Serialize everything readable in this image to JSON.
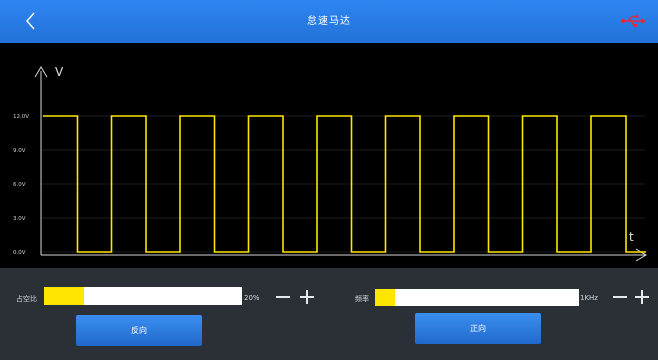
{
  "header": {
    "title": "怠速马达",
    "back_icon": "chevron-left-icon",
    "usb_icon": "usb-icon",
    "usb_color": "#e8283a"
  },
  "scope": {
    "axis_y_label": "V",
    "axis_x_label": "t",
    "y_ticks": [
      "12.0V",
      "9.0V",
      "6.0V",
      "3.0V",
      "0.0V"
    ],
    "trace_color": "#ffe600"
  },
  "chart_data": {
    "type": "line",
    "title": "",
    "xlabel": "t",
    "ylabel": "V",
    "ylim": [
      0,
      12
    ],
    "y_ticks": [
      0,
      3,
      6,
      9,
      12
    ],
    "waveform": "square",
    "high": 12.0,
    "low": 0.0,
    "cycles": 9,
    "duty_cycle": 0.5
  },
  "controls": {
    "duty": {
      "label": "占空比",
      "value": "20%",
      "level": 0.2
    },
    "freq": {
      "label": "频率",
      "value": "1KHz",
      "level": 0.1
    },
    "reverse_button": "反向",
    "forward_button": "正向",
    "minus_icon": "minus-icon",
    "plus_icon": "plus-icon"
  }
}
